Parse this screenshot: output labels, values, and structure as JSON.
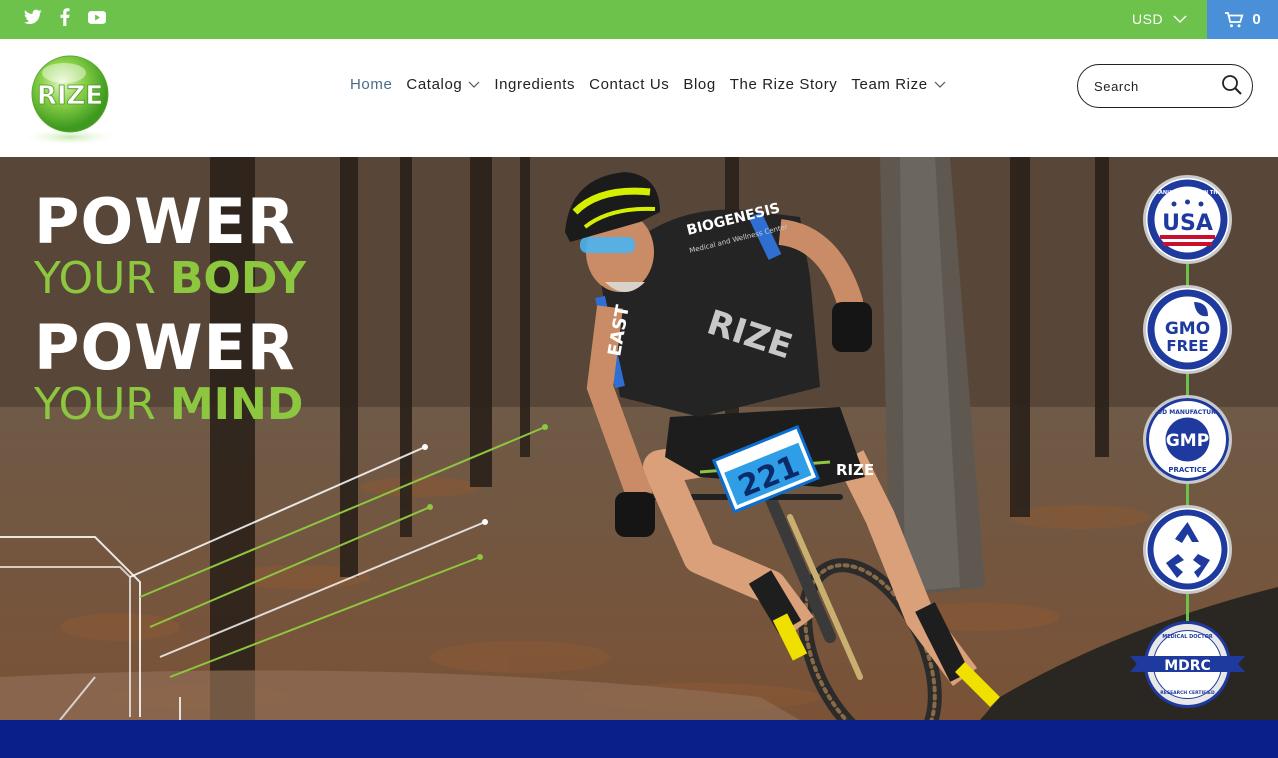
{
  "topbar": {
    "social": [
      {
        "name": "twitter-icon"
      },
      {
        "name": "facebook-icon"
      },
      {
        "name": "youtube-icon"
      }
    ],
    "currency": "USD",
    "cart_count": "0",
    "colors": {
      "bar": "#6cc24a",
      "cart": "#4a90d9"
    }
  },
  "header": {
    "logo_text": "RIZE",
    "nav": [
      {
        "label": "Home",
        "active": true
      },
      {
        "label": "Catalog",
        "dropdown": true
      },
      {
        "label": "Ingredients"
      },
      {
        "label": "Contact Us"
      },
      {
        "label": "Blog"
      },
      {
        "label": "The Rize Story"
      },
      {
        "label": "Team Rize",
        "dropdown": true
      }
    ],
    "search": {
      "placeholder": "Search"
    }
  },
  "hero": {
    "headline": {
      "line1": "POWER",
      "line2a": "YOUR ",
      "line2b": "BODY",
      "line3": "POWER",
      "line4a": "YOUR ",
      "line4b": "MIND"
    },
    "rider": {
      "jersey_brand": "BIOGENESIS",
      "jersey_sub": "Medical and Wellness Center",
      "jersey_print": "RIZE",
      "sleeve": "EAST",
      "number_plate": "221",
      "shorts": "RIZE"
    },
    "badges": [
      {
        "name": "usa-badge",
        "top": "MANUFACTURED IN THE",
        "main": "USA"
      },
      {
        "name": "gmo-free-badge",
        "main": "GMO",
        "sub": "FREE"
      },
      {
        "name": "gmp-badge",
        "top": "GOOD MANUFACTURING",
        "main": "GMP",
        "bottom": "PRACTICE"
      },
      {
        "name": "recycle-badge"
      },
      {
        "name": "mdrc-badge",
        "top": "MEDICAL DOCTOR",
        "main": "MDRC",
        "bottom": "RESEARCH CERTIFIED"
      }
    ],
    "colors": {
      "accent_green": "#8dc63f",
      "badge_blue": "#1f3a9e",
      "badge_red": "#c8102e"
    }
  },
  "strip": {
    "color": "#0b1f8a"
  }
}
